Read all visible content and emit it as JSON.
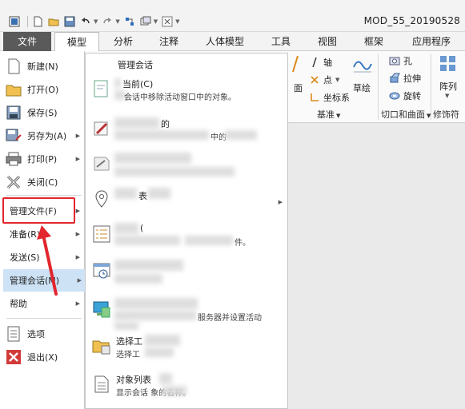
{
  "window": {
    "title": "MOD_55_20190528"
  },
  "quick_access": {
    "icons": [
      "window-icon",
      "new-icon",
      "open-icon",
      "save-icon",
      "undo-icon",
      "redo-icon",
      "regenerate-icon",
      "window-switch-icon",
      "close-window-icon"
    ]
  },
  "tabs": [
    "文件",
    "模型",
    "分析",
    "注释",
    "人体模型",
    "工具",
    "视图",
    "框架",
    "应用程序"
  ],
  "ribbon": {
    "axis": "轴",
    "point": "点",
    "coord": "坐标系",
    "plane_short": "面",
    "sketch": "草绘",
    "hole": "孔",
    "stretch": "拉伸",
    "rotate": "旋转",
    "array": "阵列",
    "group_datum": "基准",
    "group_cut": "切口和曲面",
    "group_modifier": "修饰符"
  },
  "file_menu": {
    "items": [
      {
        "label": "新建(N)"
      },
      {
        "label": "打开(O)"
      },
      {
        "label": "保存(S)"
      },
      {
        "label": "另存为(A)"
      },
      {
        "label": "打印(P)"
      },
      {
        "label": "关闭(C)"
      },
      {
        "label": "管理文件(F)"
      },
      {
        "label": "准备(R)"
      },
      {
        "label": "发送(S)"
      },
      {
        "label": "管理会话(M)"
      },
      {
        "label": "帮助"
      },
      {
        "label": "选项"
      },
      {
        "label": "退出(X)"
      }
    ]
  },
  "submenu": {
    "header": "管理会话",
    "items": [
      {
        "title": "当前(C)",
        "desc": "会话中移除活动窗口中的对象。"
      },
      {
        "title": "的",
        "desc": "中的"
      },
      {
        "title": "",
        "desc": ""
      },
      {
        "title": "表",
        "desc": ""
      },
      {
        "title": "(",
        "desc": "件。"
      },
      {
        "title": "",
        "desc": ""
      },
      {
        "title": "",
        "desc": "服务器并设置活动"
      },
      {
        "title": "选择工",
        "desc": "选择工"
      },
      {
        "title": "对象列表",
        "desc": "显示会话 象的名称。"
      }
    ]
  },
  "colors": {
    "accent_red": "#e2262d",
    "file_tab_bg": "#5a5a5a",
    "active_item": "#cde2f5"
  }
}
